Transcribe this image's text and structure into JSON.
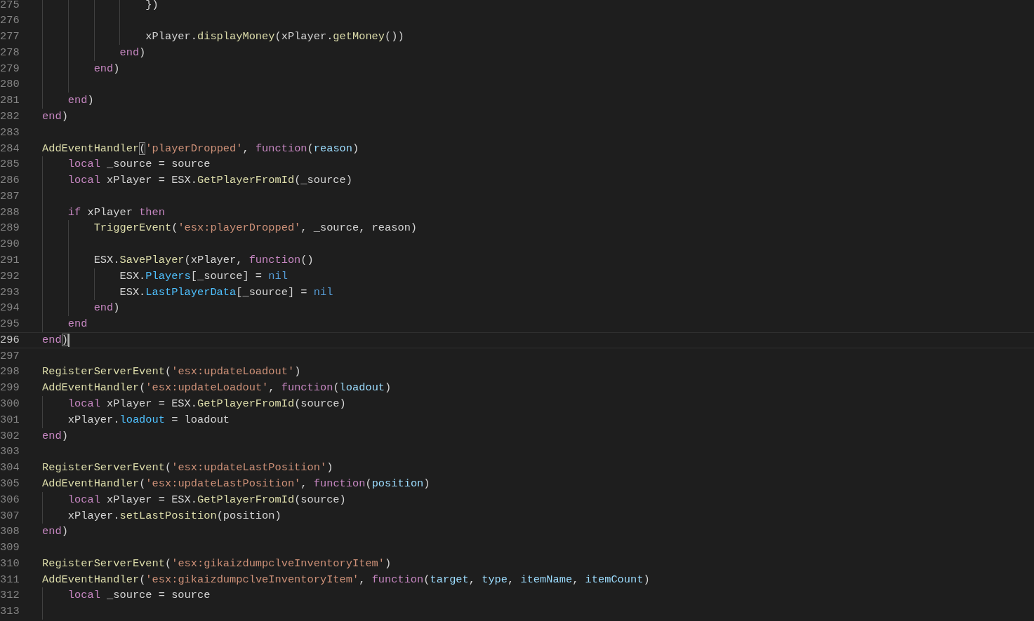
{
  "editor": {
    "lines": [
      {
        "children": [
          {
            "children": [
              {
                "children": [
                  {
                    "children": [
                      {
                        "number": "275",
                        "current": false,
                        "tokens": [
                          {
                            "text": "})",
                            "kind": "plain"
                          }
                        ]
                      },
                      {
                        "number": "276",
                        "current": false
                      },
                      {
                        "number": "277",
                        "current": false,
                        "tokens": [
                          {
                            "text": "xPlayer.",
                            "kind": "plain"
                          },
                          {
                            "text": "displayMoney",
                            "kind": "function"
                          },
                          {
                            "text": "(xPlayer.",
                            "kind": "plain"
                          },
                          {
                            "text": "getMoney",
                            "kind": "function"
                          },
                          {
                            "text": "())",
                            "kind": "plain"
                          }
                        ]
                      }
                    ]
                  },
                  {
                    "number": "278",
                    "current": false,
                    "tokens": [
                      {
                        "text": "end",
                        "kind": "keyword"
                      },
                      {
                        "text": ")",
                        "kind": "plain"
                      }
                    ]
                  }
                ]
              },
              {
                "number": "279",
                "current": false,
                "tokens": [
                  {
                    "text": "end",
                    "kind": "keyword"
                  },
                  {
                    "text": ")",
                    "kind": "plain"
                  }
                ]
              },
              {
                "number": "280",
                "current": false
              }
            ]
          },
          {
            "number": "281",
            "current": false,
            "tokens": [
              {
                "text": "end",
                "kind": "keyword"
              },
              {
                "text": ")",
                "kind": "plain"
              }
            ]
          }
        ]
      },
      {
        "number": "282",
        "current": false,
        "tokens": [
          {
            "text": "end",
            "kind": "keyword"
          },
          {
            "text": ")",
            "kind": "plain"
          }
        ]
      },
      {
        "number": "283",
        "current": false
      },
      {
        "number": "284",
        "current": false,
        "tokens": [
          {
            "text": "AddEventHandler",
            "kind": "function"
          },
          {
            "text": "(",
            "kind": "match"
          },
          {
            "text": "'playerDropped'",
            "kind": "string"
          },
          {
            "text": ", ",
            "kind": "plain"
          },
          {
            "text": "function",
            "kind": "keyword"
          },
          {
            "text": "(",
            "kind": "plain"
          },
          {
            "text": "reason",
            "kind": "variable"
          },
          {
            "text": ")",
            "kind": "plain"
          }
        ],
        "children": [
          {
            "number": "285",
            "current": false,
            "tokens": [
              {
                "text": "local",
                "kind": "keyword"
              },
              {
                "text": " _source = source",
                "kind": "plain"
              }
            ]
          },
          {
            "number": "286",
            "current": false,
            "tokens": [
              {
                "text": "local",
                "kind": "keyword"
              },
              {
                "text": " xPlayer = ESX.",
                "kind": "plain"
              },
              {
                "text": "GetPlayerFromId",
                "kind": "function"
              },
              {
                "text": "(_source)",
                "kind": "plain"
              }
            ]
          },
          {
            "number": "287",
            "current": false
          },
          {
            "number": "288",
            "current": false,
            "tokens": [
              {
                "text": "if",
                "kind": "keyword"
              },
              {
                "text": " xPlayer ",
                "kind": "plain"
              },
              {
                "text": "then",
                "kind": "keyword"
              }
            ],
            "children": [
              {
                "number": "289",
                "current": false,
                "tokens": [
                  {
                    "text": "TriggerEvent",
                    "kind": "function"
                  },
                  {
                    "text": "(",
                    "kind": "plain"
                  },
                  {
                    "text": "'esx:playerDropped'",
                    "kind": "string"
                  },
                  {
                    "text": ", _source, reason)",
                    "kind": "plain"
                  }
                ]
              },
              {
                "number": "290",
                "current": false
              },
              {
                "number": "291",
                "current": false,
                "tokens": [
                  {
                    "text": "ESX.",
                    "kind": "plain"
                  },
                  {
                    "text": "SavePlayer",
                    "kind": "function"
                  },
                  {
                    "text": "(xPlayer, ",
                    "kind": "plain"
                  },
                  {
                    "text": "function",
                    "kind": "keyword"
                  },
                  {
                    "text": "()",
                    "kind": "plain"
                  }
                ],
                "children": [
                  {
                    "number": "292",
                    "current": false,
                    "tokens": [
                      {
                        "text": "ESX.",
                        "kind": "plain"
                      },
                      {
                        "text": "Players",
                        "kind": "property"
                      },
                      {
                        "text": "[_source] = ",
                        "kind": "plain"
                      },
                      {
                        "text": "nil",
                        "kind": "constant"
                      }
                    ]
                  },
                  {
                    "number": "293",
                    "current": false,
                    "tokens": [
                      {
                        "text": "ESX.",
                        "kind": "plain"
                      },
                      {
                        "text": "LastPlayerData",
                        "kind": "property"
                      },
                      {
                        "text": "[_source] = ",
                        "kind": "plain"
                      },
                      {
                        "text": "nil",
                        "kind": "constant"
                      }
                    ]
                  }
                ]
              },
              {
                "number": "294",
                "current": false,
                "tokens": [
                  {
                    "text": "end",
                    "kind": "keyword"
                  },
                  {
                    "text": ")",
                    "kind": "plain"
                  }
                ]
              }
            ]
          },
          {
            "number": "295",
            "current": false,
            "tokens": [
              {
                "text": "end",
                "kind": "keyword"
              }
            ]
          }
        ]
      },
      {
        "number": "296",
        "current": true,
        "tokens": [
          {
            "text": "end",
            "kind": "keyword"
          },
          {
            "text": ")",
            "kind": "match"
          }
        ]
      },
      {
        "number": "297",
        "current": false
      },
      {
        "number": "298",
        "current": false,
        "tokens": [
          {
            "text": "RegisterServerEvent",
            "kind": "function"
          },
          {
            "text": "(",
            "kind": "plain"
          },
          {
            "text": "'esx:updateLoadout'",
            "kind": "string"
          },
          {
            "text": ")",
            "kind": "plain"
          }
        ]
      },
      {
        "number": "299",
        "current": false,
        "tokens": [
          {
            "text": "AddEventHandler",
            "kind": "function"
          },
          {
            "text": "(",
            "kind": "plain"
          },
          {
            "text": "'esx:updateLoadout'",
            "kind": "string"
          },
          {
            "text": ", ",
            "kind": "plain"
          },
          {
            "text": "function",
            "kind": "keyword"
          },
          {
            "text": "(",
            "kind": "plain"
          },
          {
            "text": "loadout",
            "kind": "variable"
          },
          {
            "text": ")",
            "kind": "plain"
          }
        ],
        "children": [
          {
            "number": "300",
            "current": false,
            "tokens": [
              {
                "text": "local",
                "kind": "keyword"
              },
              {
                "text": " xPlayer = ESX.",
                "kind": "plain"
              },
              {
                "text": "GetPlayerFromId",
                "kind": "function"
              },
              {
                "text": "(source)",
                "kind": "plain"
              }
            ]
          },
          {
            "number": "301",
            "current": false,
            "tokens": [
              {
                "text": "xPlayer.",
                "kind": "plain"
              },
              {
                "text": "loadout",
                "kind": "property"
              },
              {
                "text": " = loadout",
                "kind": "plain"
              }
            ]
          }
        ]
      },
      {
        "number": "302",
        "current": false,
        "tokens": [
          {
            "text": "end",
            "kind": "keyword"
          },
          {
            "text": ")",
            "kind": "plain"
          }
        ]
      },
      {
        "number": "303",
        "current": false
      },
      {
        "number": "304",
        "current": false,
        "tokens": [
          {
            "text": "RegisterServerEvent",
            "kind": "function"
          },
          {
            "text": "(",
            "kind": "plain"
          },
          {
            "text": "'esx:updateLastPosition'",
            "kind": "string"
          },
          {
            "text": ")",
            "kind": "plain"
          }
        ]
      },
      {
        "number": "305",
        "current": false,
        "tokens": [
          {
            "text": "AddEventHandler",
            "kind": "function"
          },
          {
            "text": "(",
            "kind": "plain"
          },
          {
            "text": "'esx:updateLastPosition'",
            "kind": "string"
          },
          {
            "text": ", ",
            "kind": "plain"
          },
          {
            "text": "function",
            "kind": "keyword"
          },
          {
            "text": "(",
            "kind": "plain"
          },
          {
            "text": "position",
            "kind": "variable"
          },
          {
            "text": ")",
            "kind": "plain"
          }
        ],
        "children": [
          {
            "number": "306",
            "current": false,
            "tokens": [
              {
                "text": "local",
                "kind": "keyword"
              },
              {
                "text": " xPlayer = ESX.",
                "kind": "plain"
              },
              {
                "text": "GetPlayerFromId",
                "kind": "function"
              },
              {
                "text": "(source)",
                "kind": "plain"
              }
            ]
          },
          {
            "number": "307",
            "current": false,
            "tokens": [
              {
                "text": "xPlayer.",
                "kind": "plain"
              },
              {
                "text": "setLastPosition",
                "kind": "function"
              },
              {
                "text": "(position)",
                "kind": "plain"
              }
            ]
          }
        ]
      },
      {
        "number": "308",
        "current": false,
        "tokens": [
          {
            "text": "end",
            "kind": "keyword"
          },
          {
            "text": ")",
            "kind": "plain"
          }
        ]
      },
      {
        "number": "309",
        "current": false
      },
      {
        "number": "310",
        "current": false,
        "tokens": [
          {
            "text": "RegisterServerEvent",
            "kind": "function"
          },
          {
            "text": "(",
            "kind": "plain"
          },
          {
            "text": "'esx:gikaizdumpclveInventoryItem'",
            "kind": "string"
          },
          {
            "text": ")",
            "kind": "plain"
          }
        ]
      },
      {
        "number": "311",
        "current": false,
        "tokens": [
          {
            "text": "AddEventHandler",
            "kind": "function"
          },
          {
            "text": "(",
            "kind": "plain"
          },
          {
            "text": "'esx:gikaizdumpclveInventoryItem'",
            "kind": "string"
          },
          {
            "text": ", ",
            "kind": "plain"
          },
          {
            "text": "function",
            "kind": "keyword"
          },
          {
            "text": "(",
            "kind": "plain"
          },
          {
            "text": "target",
            "kind": "variable"
          },
          {
            "text": ", ",
            "kind": "plain"
          },
          {
            "text": "type",
            "kind": "variable"
          },
          {
            "text": ", ",
            "kind": "plain"
          },
          {
            "text": "itemName",
            "kind": "variable"
          },
          {
            "text": ", ",
            "kind": "plain"
          },
          {
            "text": "itemCount",
            "kind": "variable"
          },
          {
            "text": ")",
            "kind": "plain"
          }
        ],
        "children": [
          {
            "number": "312",
            "current": false,
            "tokens": [
              {
                "text": "local",
                "kind": "keyword"
              },
              {
                "text": " _source = source",
                "kind": "plain"
              }
            ]
          },
          {
            "number": "313",
            "current": false
          }
        ]
      }
    ]
  }
}
